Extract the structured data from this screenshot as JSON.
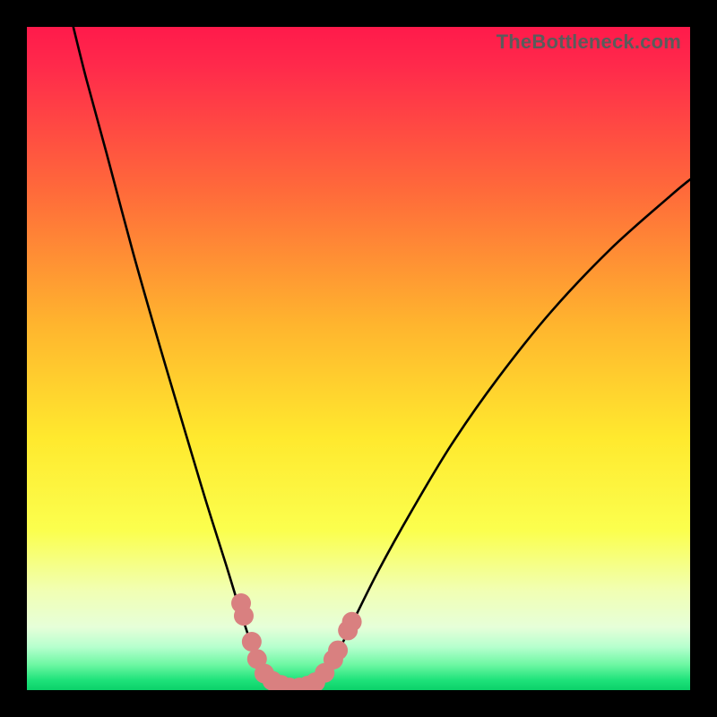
{
  "watermark": "TheBottleneck.com",
  "chart_data": {
    "type": "line",
    "title": "",
    "xlabel": "",
    "ylabel": "",
    "xlim": [
      0,
      100
    ],
    "ylim": [
      0,
      100
    ],
    "gradient_stops": [
      {
        "offset": 0.0,
        "color": "#ff1a4b"
      },
      {
        "offset": 0.06,
        "color": "#ff2a4b"
      },
      {
        "offset": 0.25,
        "color": "#ff6b3a"
      },
      {
        "offset": 0.45,
        "color": "#ffb52e"
      },
      {
        "offset": 0.62,
        "color": "#ffe92e"
      },
      {
        "offset": 0.76,
        "color": "#fbff4e"
      },
      {
        "offset": 0.85,
        "color": "#f1ffb3"
      },
      {
        "offset": 0.905,
        "color": "#e6ffd9"
      },
      {
        "offset": 0.935,
        "color": "#b6ffce"
      },
      {
        "offset": 0.962,
        "color": "#6cf7a2"
      },
      {
        "offset": 0.985,
        "color": "#1ee27a"
      },
      {
        "offset": 1.0,
        "color": "#0bd169"
      }
    ],
    "series": [
      {
        "name": "bottleneck-curve",
        "style": "black-thin",
        "points": [
          {
            "x": 7.0,
            "y": 100.0
          },
          {
            "x": 9.0,
            "y": 92.0
          },
          {
            "x": 12.0,
            "y": 81.0
          },
          {
            "x": 16.0,
            "y": 66.0
          },
          {
            "x": 20.0,
            "y": 52.0
          },
          {
            "x": 24.0,
            "y": 38.5
          },
          {
            "x": 27.0,
            "y": 28.5
          },
          {
            "x": 30.0,
            "y": 19.0
          },
          {
            "x": 32.0,
            "y": 12.5
          },
          {
            "x": 34.0,
            "y": 6.5
          },
          {
            "x": 36.0,
            "y": 2.0
          },
          {
            "x": 38.0,
            "y": 0.5
          },
          {
            "x": 40.0,
            "y": 0.0
          },
          {
            "x": 42.0,
            "y": 0.3
          },
          {
            "x": 44.0,
            "y": 1.5
          },
          {
            "x": 46.5,
            "y": 5.0
          },
          {
            "x": 49.0,
            "y": 10.0
          },
          {
            "x": 53.0,
            "y": 18.0
          },
          {
            "x": 58.0,
            "y": 27.0
          },
          {
            "x": 64.0,
            "y": 37.0
          },
          {
            "x": 71.0,
            "y": 47.0
          },
          {
            "x": 79.0,
            "y": 57.0
          },
          {
            "x": 88.0,
            "y": 66.5
          },
          {
            "x": 97.0,
            "y": 74.5
          },
          {
            "x": 100.0,
            "y": 77.0
          }
        ]
      },
      {
        "name": "marker-dots",
        "style": "salmon-dot",
        "points": [
          {
            "x": 32.3,
            "y": 13.1
          },
          {
            "x": 32.7,
            "y": 11.2
          },
          {
            "x": 33.9,
            "y": 7.3
          },
          {
            "x": 34.7,
            "y": 4.7
          },
          {
            "x": 35.8,
            "y": 2.5
          },
          {
            "x": 37.0,
            "y": 1.4
          },
          {
            "x": 38.3,
            "y": 0.8
          },
          {
            "x": 39.6,
            "y": 0.4
          },
          {
            "x": 41.1,
            "y": 0.4
          },
          {
            "x": 42.4,
            "y": 0.7
          },
          {
            "x": 43.5,
            "y": 1.2
          },
          {
            "x": 44.9,
            "y": 2.6
          },
          {
            "x": 46.2,
            "y": 4.6
          },
          {
            "x": 46.9,
            "y": 6.0
          },
          {
            "x": 48.4,
            "y": 9.0
          },
          {
            "x": 49.0,
            "y": 10.3
          }
        ]
      }
    ]
  }
}
